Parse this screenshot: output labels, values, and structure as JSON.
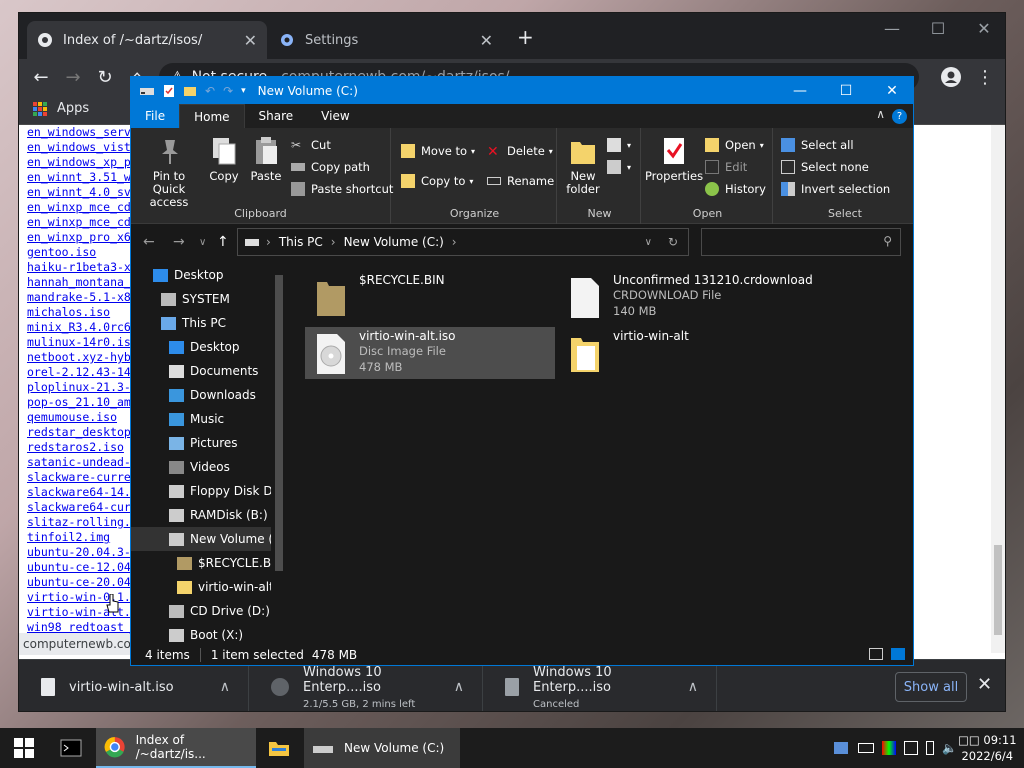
{
  "chrome": {
    "tabs": [
      {
        "title": "Index of /~dartz/isos/",
        "close": "✕"
      },
      {
        "title": "Settings",
        "close": "✕"
      }
    ],
    "new_tab": "+",
    "win_controls": {
      "minimize": "—",
      "maximize": "☐",
      "close": "✕"
    },
    "nav": {
      "back": "←",
      "forward": "→",
      "reload": "↻",
      "home": "⌂"
    },
    "omnibox": {
      "security": "Not secure",
      "url": "computernewb.com/~dartz/isos/"
    },
    "bookmarks": {
      "apps": "Apps"
    },
    "files": [
      "en_windows_serv",
      "en_windows_vist",
      "en_windows_xp_p",
      "en_winnt_3.51_w",
      "en_winnt_4.0_sv",
      "en_winxp_mce_cd",
      "en_winxp_mce_cd",
      "en_winxp_pro_x6",
      "gentoo.iso",
      "haiku-r1beta3-x",
      "hannah_montana_",
      "mandrake-5.1-x8",
      "michalos.iso",
      "minix_R3.4.0rc6",
      "mulinux-14r0.is",
      "netboot.xyz-hyb",
      "orel-2.12.43-14",
      "ploplinux-21.3-",
      "pop-os_21.10_am",
      "qemumouse.iso",
      "redstar_desktop",
      "redstaros2.iso",
      "satanic-undead-",
      "slackware-curre",
      "slackware64-14.",
      "slackware64-cur",
      "slitaz-rolling.",
      "tinfoil2.img",
      "ubuntu-20.04.3-",
      "ubuntu-ce-12.04",
      "ubuntu-ce-20.04",
      "virtio-win-0.1.",
      "virtio-win-alt.",
      "win98_redtoast_"
    ],
    "status_url": "computernewb.com",
    "downloads": [
      {
        "name": "virtio-win-alt.iso",
        "sub": ""
      },
      {
        "name": "Windows 10 Enterp....iso",
        "sub": "2.1/5.5 GB, 2 mins left"
      },
      {
        "name": "Windows 10 Enterp....iso",
        "sub": "Canceled"
      }
    ],
    "show_all": "Show all",
    "dl_close": "✕",
    "dl_caret": "∧"
  },
  "explorer": {
    "title": "New Volume (C:)",
    "win_controls": {
      "minimize": "—",
      "maximize": "☐",
      "close": "✕"
    },
    "ribbon_tabs": [
      "File",
      "Home",
      "Share",
      "View"
    ],
    "help": "?",
    "collapse": "∧",
    "groups": {
      "clipboard": {
        "label": "Clipboard",
        "pin": "Pin to Quick access",
        "copy": "Copy",
        "paste": "Paste",
        "cut": "Cut",
        "copy_path": "Copy path",
        "paste_shortcut": "Paste shortcut"
      },
      "organize": {
        "label": "Organize",
        "move_to": "Move to",
        "copy_to": "Copy to",
        "delete": "Delete",
        "rename": "Rename"
      },
      "new": {
        "label": "New",
        "new_folder": "New folder"
      },
      "open": {
        "label": "Open",
        "properties": "Properties",
        "open": "Open",
        "edit": "Edit",
        "history": "History"
      },
      "select": {
        "label": "Select",
        "select_all": "Select all",
        "select_none": "Select none",
        "invert": "Invert selection"
      }
    },
    "address": {
      "crumbs": [
        "This PC",
        "New Volume (C:)"
      ],
      "sep": "›"
    },
    "nav_pane": [
      {
        "label": "Desktop",
        "icon": "desktop-icon",
        "indent": 0
      },
      {
        "label": "SYSTEM",
        "icon": "user-icon",
        "indent": 1
      },
      {
        "label": "This PC",
        "icon": "pc-icon",
        "indent": 1
      },
      {
        "label": "Desktop",
        "icon": "desktop-icon",
        "indent": 2
      },
      {
        "label": "Documents",
        "icon": "documents-icon",
        "indent": 2
      },
      {
        "label": "Downloads",
        "icon": "downloads-icon",
        "indent": 2
      },
      {
        "label": "Music",
        "icon": "music-icon",
        "indent": 2
      },
      {
        "label": "Pictures",
        "icon": "pictures-icon",
        "indent": 2
      },
      {
        "label": "Videos",
        "icon": "videos-icon",
        "indent": 2
      },
      {
        "label": "Floppy Disk Dri",
        "icon": "floppy-icon",
        "indent": 2
      },
      {
        "label": "RAMDisk (B:)",
        "icon": "drive-icon",
        "indent": 2
      },
      {
        "label": "New Volume (C",
        "icon": "drive-icon",
        "indent": 2
      },
      {
        "label": "$RECYCLE.BIN",
        "icon": "folder-icon",
        "indent": 3
      },
      {
        "label": "virtio-win-alt",
        "icon": "folder-icon",
        "indent": 3
      },
      {
        "label": "CD Drive (D:)",
        "icon": "cd-drive-icon",
        "indent": 2
      },
      {
        "label": "Boot (X:)",
        "icon": "drive-icon",
        "indent": 2
      }
    ],
    "items": [
      {
        "name": "$RECYCLE.BIN",
        "type": "",
        "size": ""
      },
      {
        "name": "Unconfirmed 131210.crdownload",
        "type": "CRDOWNLOAD File",
        "size": "140 MB"
      },
      {
        "name": "virtio-win-alt.iso",
        "type": "Disc Image File",
        "size": "478 MB"
      },
      {
        "name": "virtio-win-alt",
        "type": "",
        "size": ""
      }
    ],
    "status": {
      "count": "4 items",
      "selected": "1 item selected",
      "size": "478 MB"
    }
  },
  "taskbar": {
    "buttons": [
      {
        "label": "Index of /~dartz/is..."
      },
      {
        "label": "New Volume (C:)"
      }
    ],
    "clock": {
      "time": "09:11",
      "date": "2022/6/4",
      "prefix": "□□"
    }
  }
}
